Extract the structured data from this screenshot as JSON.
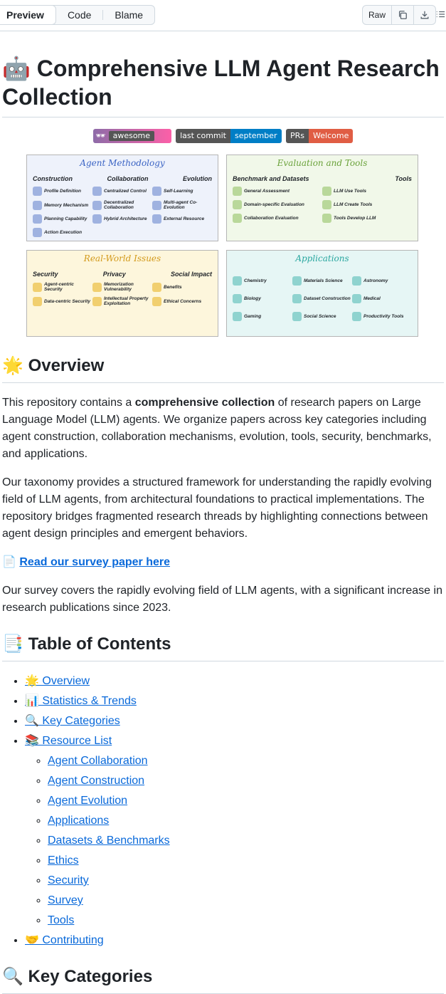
{
  "toolbar": {
    "tabs": [
      "Preview",
      "Code",
      "Blame"
    ],
    "raw_label": "Raw",
    "copy_icon": "copy-icon",
    "download_icon": "download-icon",
    "outline_icon": "list-outline-icon"
  },
  "readme": {
    "title_emoji": "🤖",
    "title": "Comprehensive LLM Agent Research Collection",
    "badges": [
      {
        "left": "awesome",
        "right": "",
        "colors": [
          "#8e6ba8",
          "#fc60a8"
        ]
      },
      {
        "left": "last commit",
        "right": "september",
        "colors": [
          "#555555",
          "#007ec6"
        ]
      },
      {
        "left": "PRs",
        "right": "Welcome",
        "colors": [
          "#555555",
          "#e05d44"
        ]
      }
    ],
    "figures": [
      {
        "title": "Agent Methodology",
        "columns": [
          "Construction",
          "Collaboration",
          "Evolution"
        ],
        "items": [
          "Profile Definition",
          "Centralized Control",
          "Self-Learning",
          "Memory Mechanism",
          "Decentralized Collaboration",
          "Multi-agent Co-Evolution",
          "Planning Capability",
          "Hybrid Architecture",
          "External Resource",
          "Action Execution"
        ],
        "bg": "#eef2fb",
        "accent": "#3b64c4"
      },
      {
        "title": "Evaluation and Tools",
        "columns": [
          "Benchmark and Datasets",
          "Tools"
        ],
        "items": [
          "General Assessment",
          "LLM Use Tools",
          "Domain-specific Evaluation",
          "LLM Create Tools",
          "Collaboration Evaluation",
          "Tools Develop LLM"
        ],
        "bg": "#f1f8e9",
        "accent": "#6aa23a"
      },
      {
        "title": "Real-World Issues",
        "columns": [
          "Security",
          "Privacy",
          "Social Impact"
        ],
        "items": [
          "Agent-centric Security",
          "Memorization Vulnerability",
          "Benefits",
          "Data-centric Security",
          "Intellectual Property Exploitation",
          "Ethical Concerns"
        ],
        "bg": "#fdf6dc",
        "accent": "#d39a1c"
      },
      {
        "title": "Applications",
        "columns": [],
        "items": [
          "Chemistry",
          "Materials Science",
          "Astronomy",
          "Biology",
          "Dataset Construction",
          "Medical",
          "Gaming",
          "Social Science",
          "Productivity Tools"
        ],
        "bg": "#e6f6f5",
        "accent": "#2aa7a0"
      }
    ],
    "overview": {
      "emoji": "🌟",
      "heading": "Overview",
      "p1_pre": "This repository contains a ",
      "p1_bold": "comprehensive collection",
      "p1_post": " of research papers on Large Language Model (LLM) agents. We organize papers across key categories including agent construction, collaboration mechanisms, evolution, tools, security, benchmarks, and applications.",
      "p2": "Our taxonomy provides a structured framework for understanding the rapidly evolving field of LLM agents, from architectural foundations to practical implementations. The repository bridges fragmented research threads by highlighting connections between agent design principles and emergent behaviors.",
      "survey_emoji": "📄",
      "survey_link": "Read our survey paper here",
      "p3": "Our survey covers the rapidly evolving field of LLM agents, with a significant increase in research publications since 2023."
    },
    "toc": {
      "emoji": "📑",
      "heading": "Table of Contents",
      "items": [
        {
          "label": "🌟 Overview"
        },
        {
          "label": "📊 Statistics & Trends"
        },
        {
          "label": "🔍 Key Categories"
        },
        {
          "label": "📚 Resource List"
        }
      ],
      "sub_items": [
        "Agent Collaboration",
        "Agent Construction",
        "Agent Evolution",
        "Applications",
        "Datasets & Benchmarks",
        "Ethics",
        "Security",
        "Survey",
        "Tools"
      ],
      "last_item": "🤝 Contributing"
    },
    "next_heading": "🔍 Key Categories"
  }
}
